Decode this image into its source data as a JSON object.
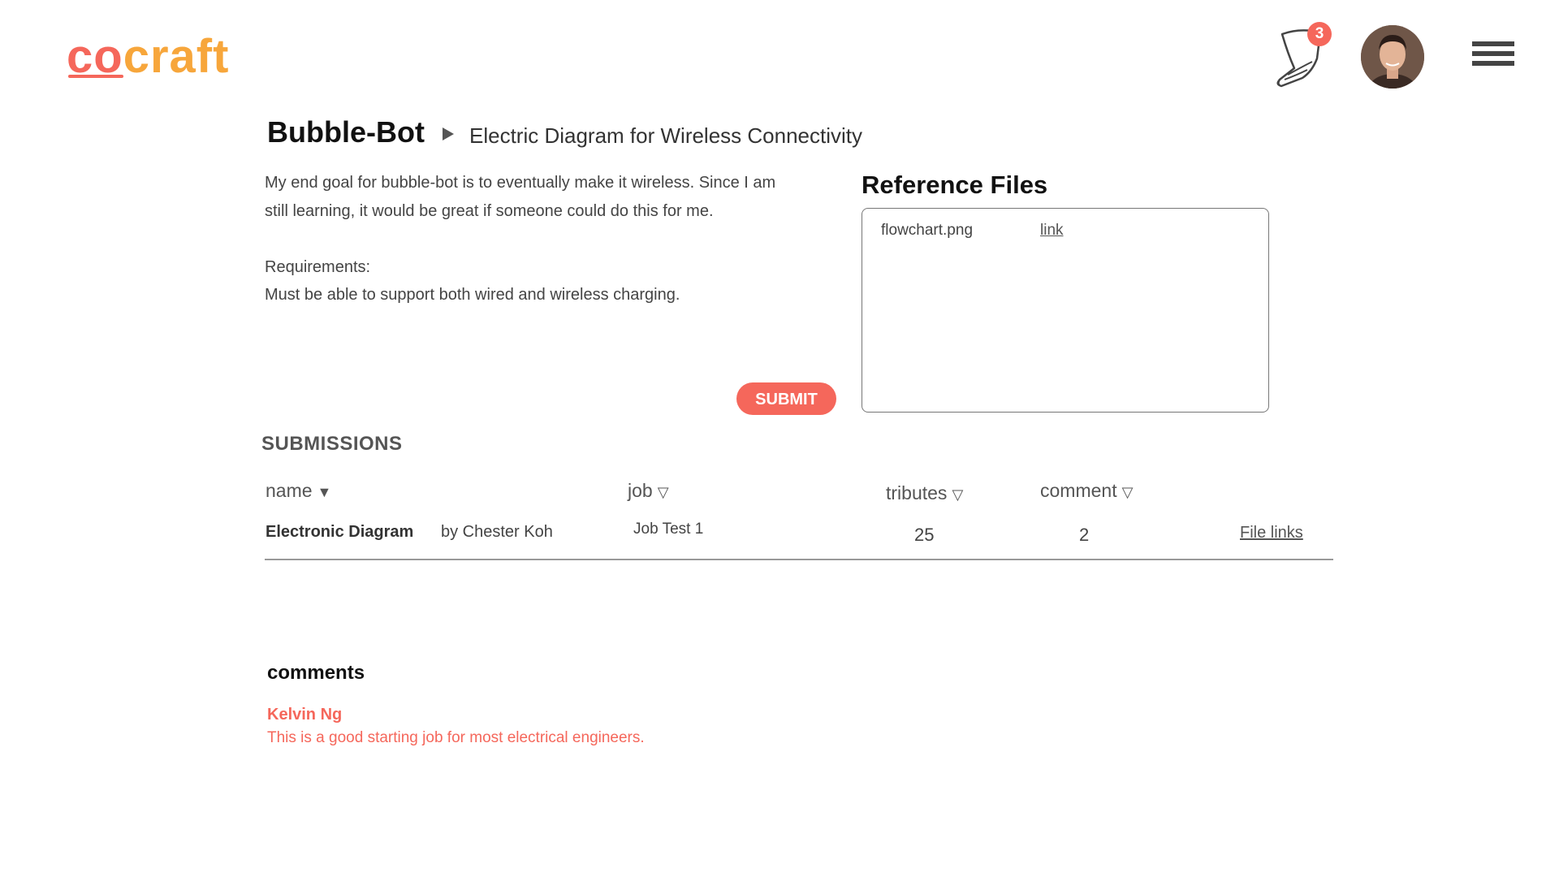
{
  "header": {
    "logo_prefix": "co",
    "logo_suffix": "craft",
    "notification_count": "3"
  },
  "project": {
    "title": "Bubble-Bot",
    "job_title": "Electric Diagram for Wireless Connectivity"
  },
  "description": {
    "line1": "My end goal for bubble-bot is to eventually make it wireless. Since I am",
    "line2": "still learning, it would be great if someone could do this for me.",
    "req_label": "Requirements:",
    "req_text": "Must be able to support both wired and wireless charging."
  },
  "submit_label": "SUBMIT",
  "reference_files": {
    "title": "Reference Files",
    "files": [
      {
        "name": "flowchart.png",
        "link_text": "link"
      }
    ]
  },
  "submissions": {
    "title": "SUBMISSIONS",
    "columns": {
      "name": "name",
      "job": "job",
      "tributes": "tributes",
      "comment": "comment"
    },
    "rows": [
      {
        "name": "Electronic Diagram",
        "by": "by Chester Koh",
        "job": "Job Test 1",
        "tributes": "25",
        "comments": "2",
        "files": "File links"
      }
    ]
  },
  "comments": {
    "title": "comments",
    "items": [
      {
        "author": "Kelvin Ng",
        "text": "This is a good starting job for most electrical engineers."
      }
    ]
  },
  "colors": {
    "accent": "#f5675b",
    "logo_orange": "#f7a63b"
  }
}
